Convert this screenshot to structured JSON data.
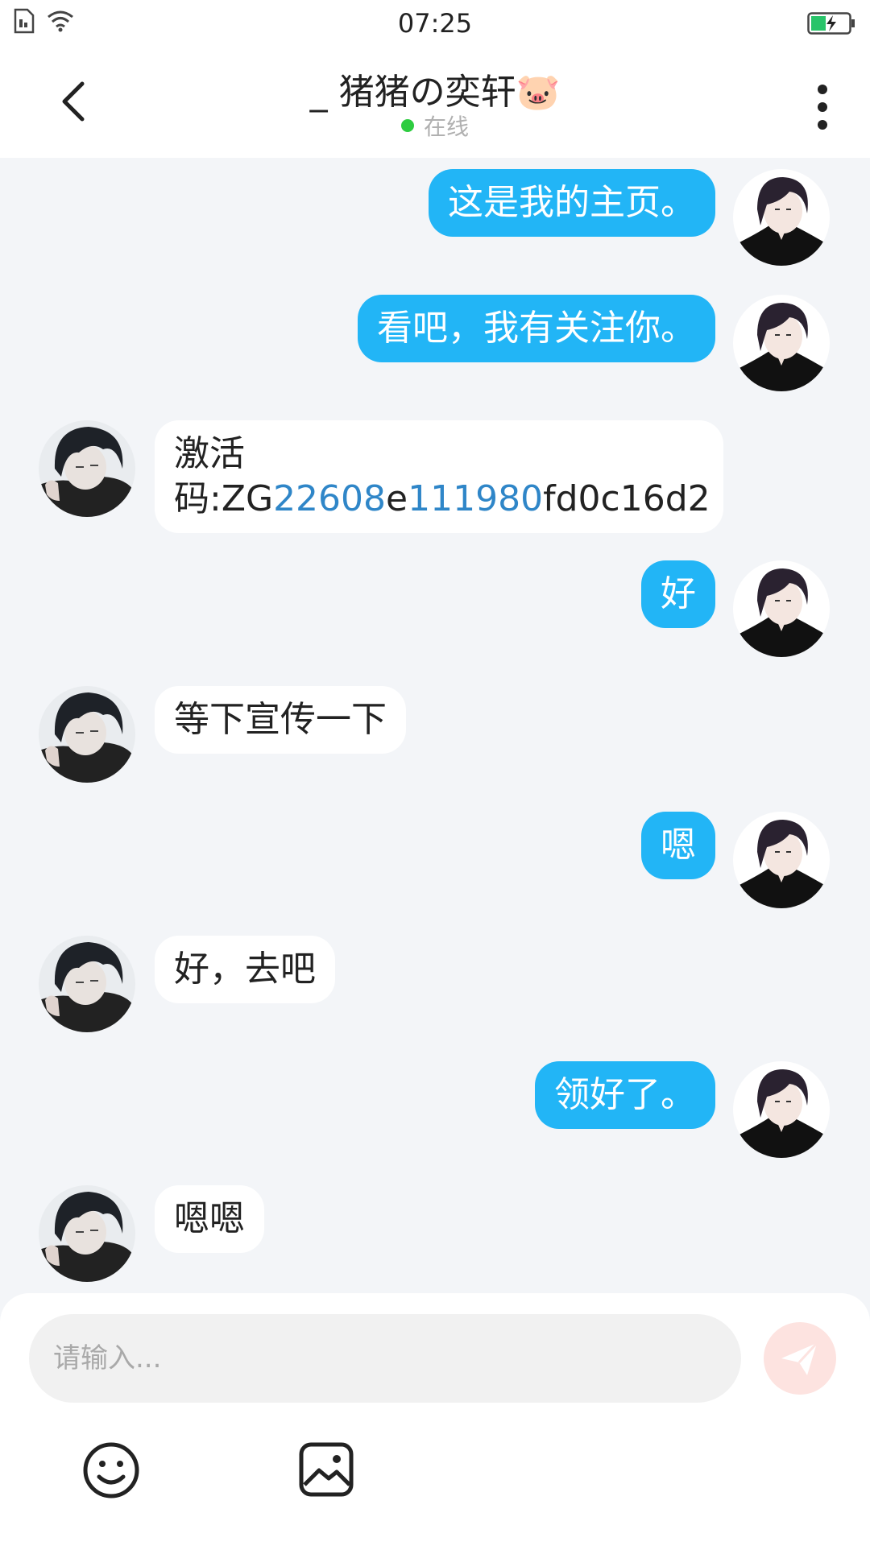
{
  "status_bar": {
    "time": "07:25"
  },
  "header": {
    "title": "_ 猪猪の奕轩",
    "title_emoji": "🐷",
    "status": "在线"
  },
  "messages": [
    {
      "dir": "out",
      "text": "这是我的主页。"
    },
    {
      "dir": "out",
      "text": "看吧，我有关注你。"
    },
    {
      "dir": "in",
      "line1": "激活",
      "line2_a": "码:ZG",
      "line2_b": "22608",
      "line2_c": "e",
      "line2_d": "111980",
      "line2_e": "fd0c16d2"
    },
    {
      "dir": "out",
      "text": "好"
    },
    {
      "dir": "in",
      "text": "等下宣传一下"
    },
    {
      "dir": "out",
      "text": "嗯"
    },
    {
      "dir": "in",
      "text": "好，去吧"
    },
    {
      "dir": "out",
      "text": "领好了。"
    },
    {
      "dir": "in",
      "text": "嗯嗯"
    }
  ],
  "composer": {
    "placeholder": "请输入..."
  },
  "colors": {
    "outgoing_bubble": "#22b5f6",
    "incoming_bubble": "#ffffff",
    "online": "#2ecc40",
    "send_button": "#fde3e0",
    "link_digits": "#2f86c8"
  }
}
